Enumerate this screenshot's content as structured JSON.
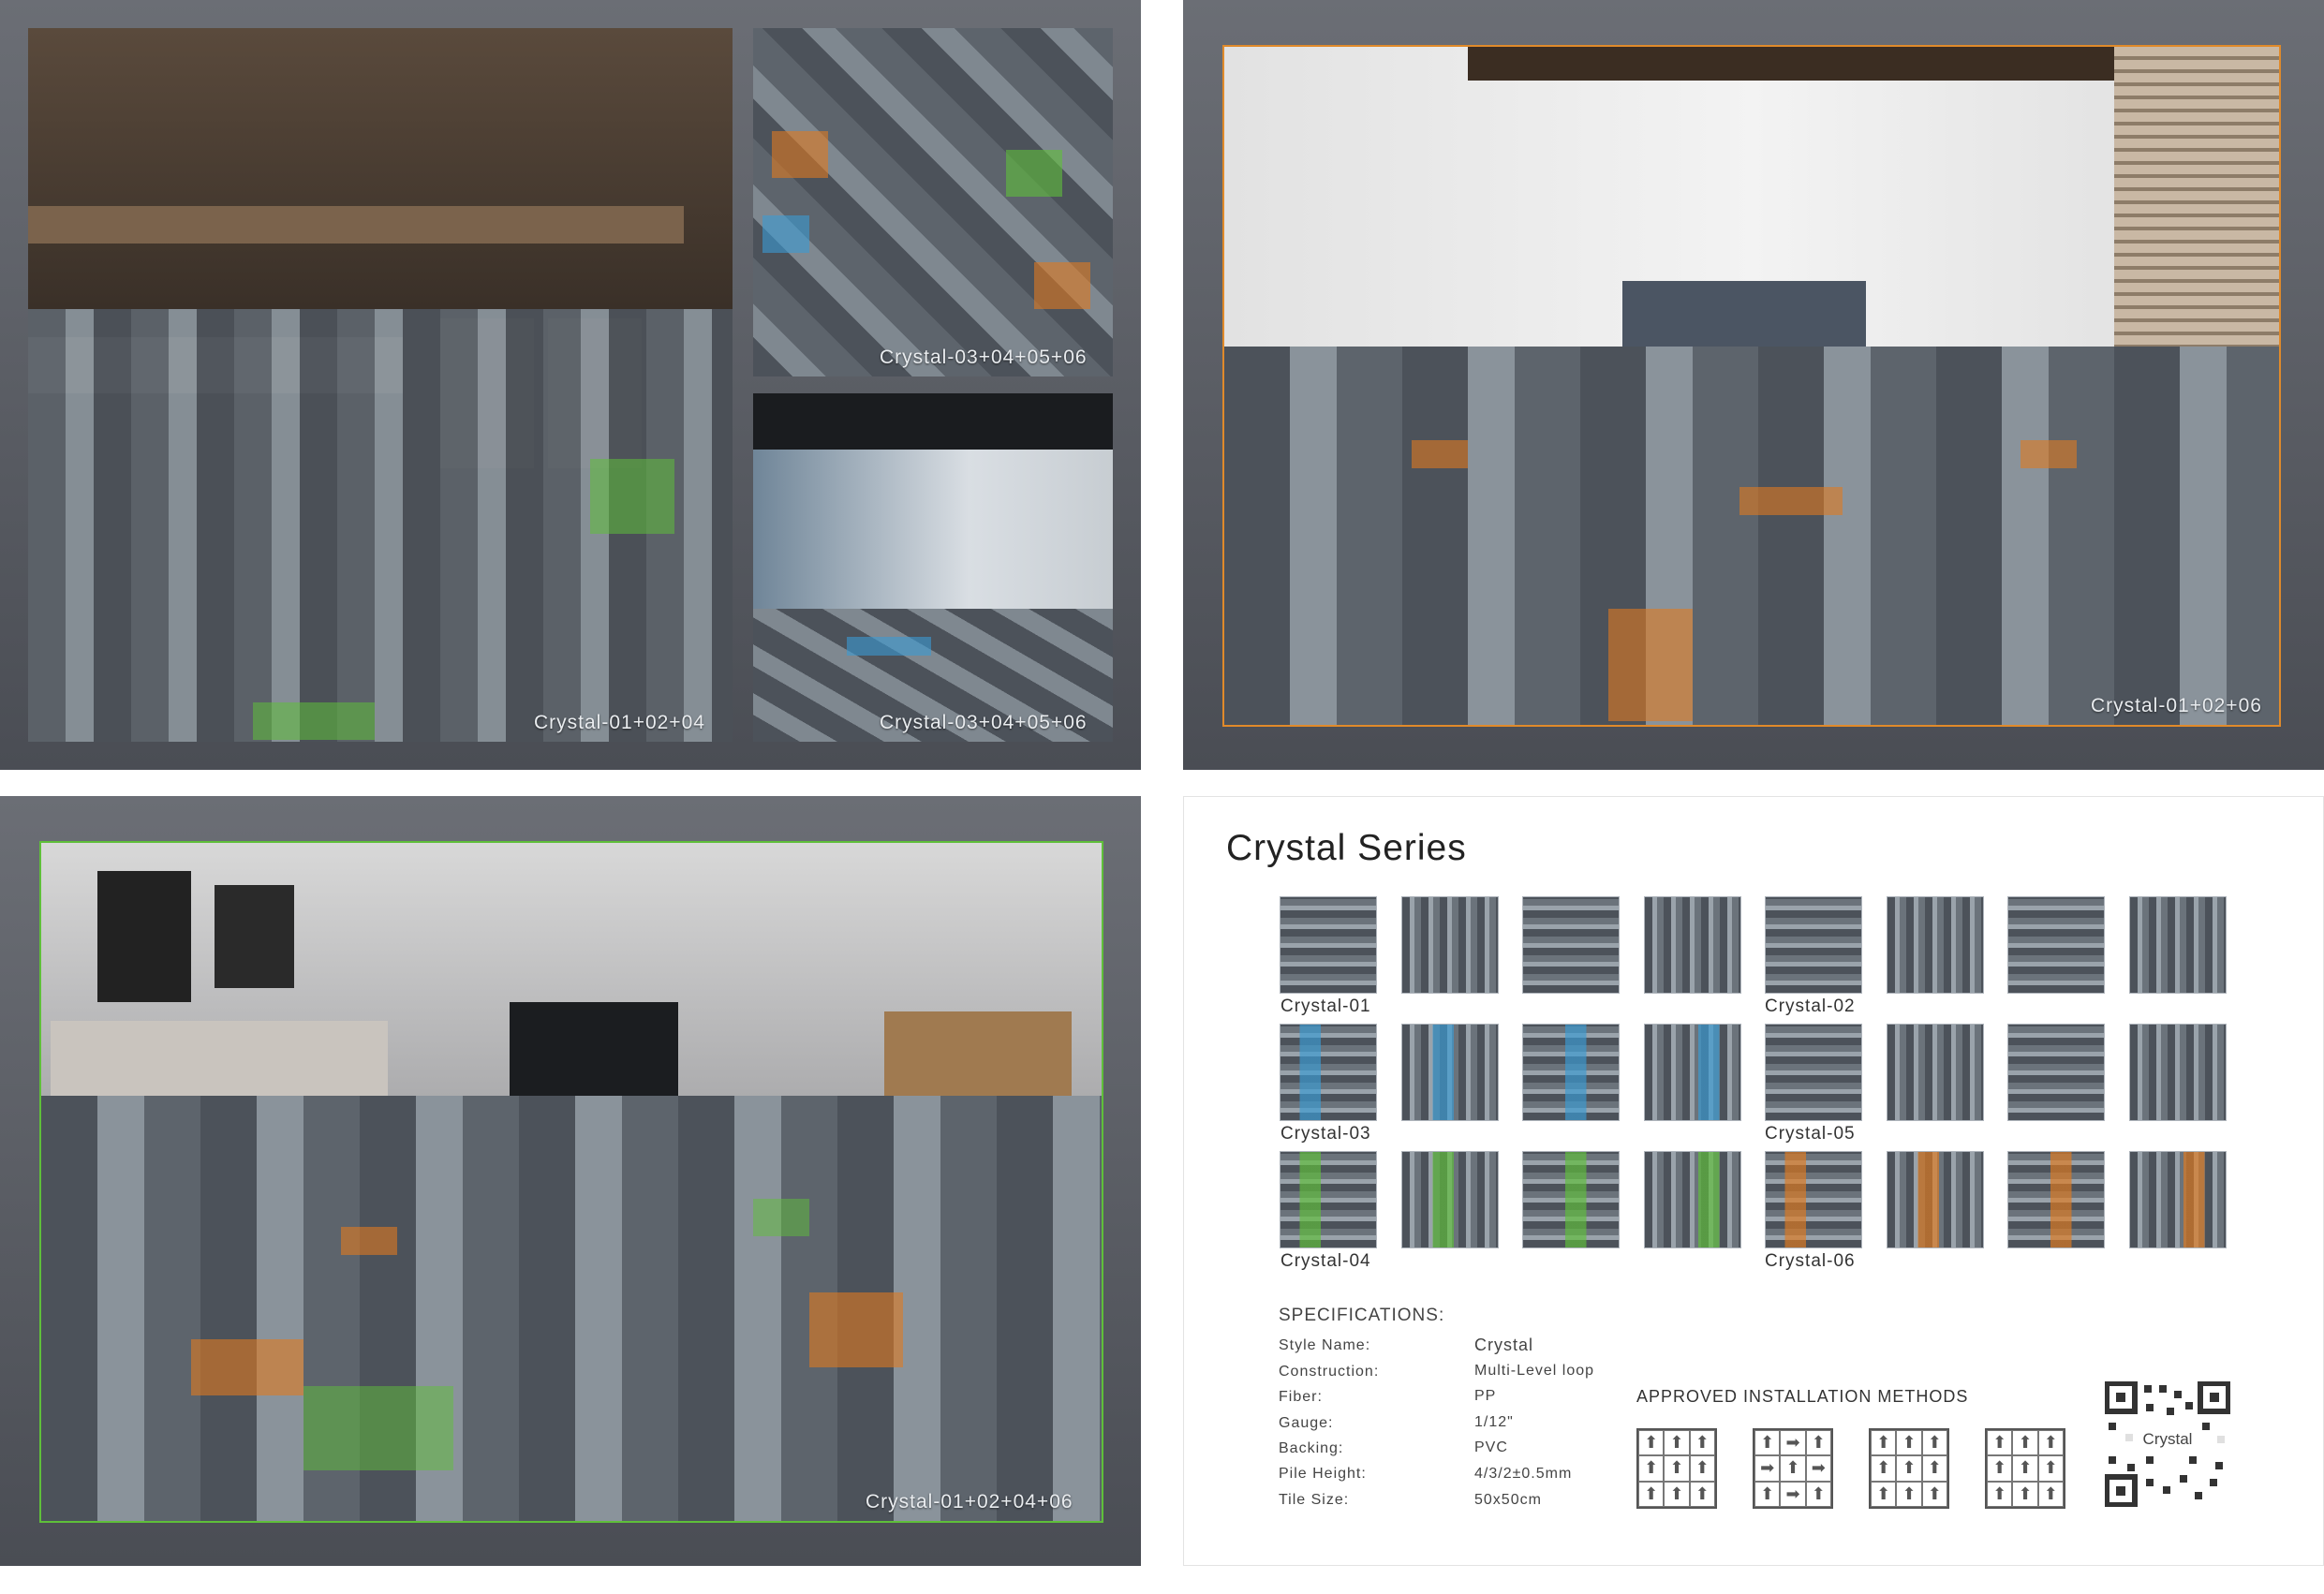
{
  "panels": {
    "top_left": {
      "main_caption": "Crystal-01+02+04",
      "right_top_caption": "Crystal-03+04+05+06",
      "right_bottom_caption": "Crystal-03+04+05+06"
    },
    "top_right": {
      "caption": "Crystal-01+02+06"
    },
    "bottom_left": {
      "caption": "Crystal-01+02+04+06"
    }
  },
  "catalog": {
    "title": "Crystal Series",
    "tile_labels": {
      "r1c1": "Crystal-01",
      "r1c5": "Crystal-02",
      "r2c1": "Crystal-03",
      "r2c5": "Crystal-05",
      "r3c1": "Crystal-04",
      "r3c5": "Crystal-06"
    },
    "specs_heading": "SPECIFICATIONS:",
    "specs": [
      {
        "k": "Style Name:",
        "v": "Crystal"
      },
      {
        "k": "Construction:",
        "v": "Multi-Level loop"
      },
      {
        "k": "Fiber:",
        "v": "PP"
      },
      {
        "k": "Gauge:",
        "v": "1/12\""
      },
      {
        "k": "Backing:",
        "v": "PVC"
      },
      {
        "k": "Pile Height:",
        "v": "4/3/2±0.5mm"
      },
      {
        "k": "Tile Size:",
        "v": "50x50cm"
      }
    ],
    "install_heading": "APPROVED INSTALLATION METHODS",
    "qr_text": "Crystal"
  },
  "colors": {
    "accent_orange": "#e07a1f",
    "accent_green": "#5fbf3a",
    "accent_blue": "#3a9bd4",
    "carpet_dark": "#4c525a",
    "carpet_light": "#9aa3ab"
  }
}
